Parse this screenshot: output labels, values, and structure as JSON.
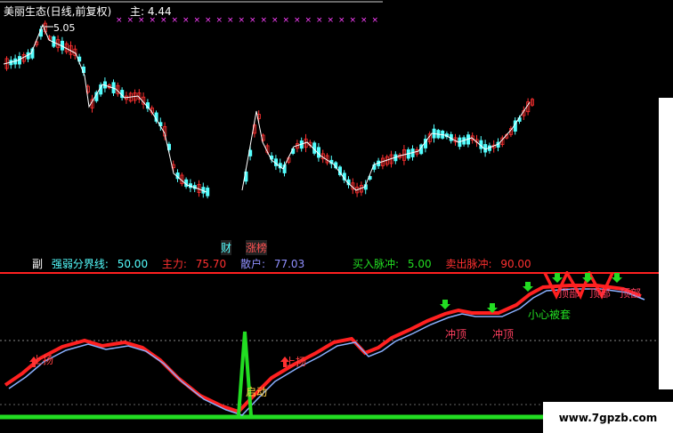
{
  "header": {
    "title": "美丽生态(日线,前复权)",
    "main_label": "主",
    "main_value": "4.44",
    "high_label": "5.05"
  },
  "events": [
    "财",
    "涨",
    "榜"
  ],
  "sub_header": {
    "prefix": "副",
    "dividing_label": "强弱分界线:",
    "dividing_value": "50.00",
    "main_force_label": "主力:",
    "main_force_value": "75.70",
    "retail_label": "散户:",
    "retail_value": "77.03",
    "buy_label": "买入脉冲:",
    "buy_value": "5.00",
    "sell_label": "卖出脉冲:",
    "sell_value": "90.00"
  },
  "annotations": {
    "up1": "上扬",
    "up2": "上扬",
    "start": "启动",
    "top1": "冲顶",
    "top2": "冲顶",
    "careful": "小心被套",
    "peak1": "顶部",
    "peak2": "顶部",
    "peak3": "顶部"
  },
  "watermark": "www.7gpzb.com",
  "colors": {
    "up": "#ff3030",
    "down": "#54ffff",
    "main_force": "#ff2020",
    "retail": "#8ab0ff",
    "pulse": "#22dd22",
    "ref_line": "#ff2020",
    "hdr_cyan": "#54ffff",
    "hdr_yellow": "#ffff54",
    "hdr_red": "#ff3030",
    "hdr_blue": "#9090ff",
    "hdr_green": "#22dd22",
    "markers": "#ff40ff"
  }
}
